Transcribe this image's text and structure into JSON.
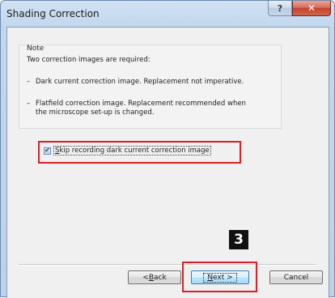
{
  "window": {
    "title": "Shading Correction",
    "help_label": "?",
    "close_label": "✕"
  },
  "note": {
    "heading": "Note",
    "intro": "Two correction images are required:",
    "bullets": [
      {
        "dash": "–",
        "lines": [
          "Dark current correction image. Replacement not imperative."
        ]
      },
      {
        "dash": "–",
        "lines": [
          "Flatfield correction image. Replacement recommended when",
          "the microscope set-up is changed."
        ]
      }
    ]
  },
  "checkbox": {
    "checked": true,
    "check_glyph": "✔",
    "label_prefix": "",
    "label_accel": "S",
    "label_rest": "kip recording dark current correction image"
  },
  "step_badge": "3",
  "buttons": {
    "back": {
      "prefix": "< ",
      "accel": "B",
      "rest": "ack"
    },
    "next": {
      "prefix": "",
      "accel": "N",
      "rest": "ext >"
    },
    "cancel": {
      "label": "Cancel"
    }
  },
  "colors": {
    "highlight": "#d8202a",
    "close": "#c0432c",
    "title_gradient_top": "#d2e2f3"
  }
}
